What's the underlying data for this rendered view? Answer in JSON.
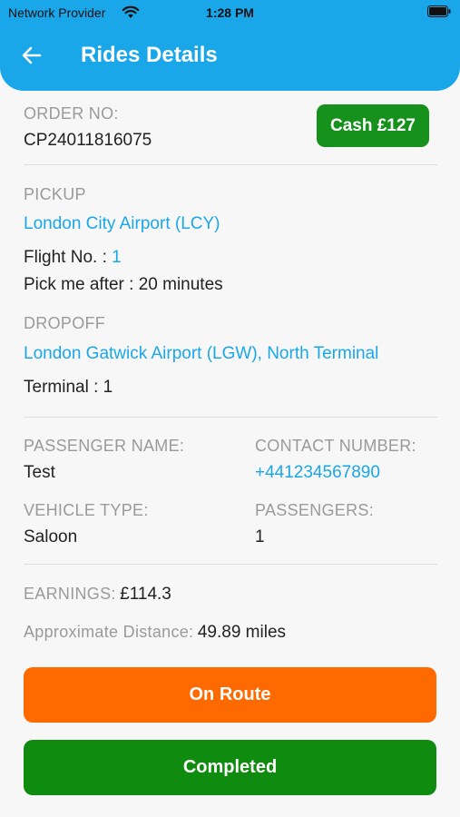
{
  "status_bar": {
    "carrier": "Network Provider",
    "time": "1:28 PM",
    "wifi_icon": "wifi-icon",
    "battery_icon": "battery-icon"
  },
  "header": {
    "title": "Rides Details",
    "back_icon": "back-arrow-icon",
    "color": "#1aa7ea"
  },
  "order": {
    "label": "ORDER NO:",
    "number": "CP24011816075",
    "payment_badge": "Cash £127",
    "badge_color": "#16911c"
  },
  "pickup": {
    "label": "PICKUP",
    "location": "London City Airport (LCY)",
    "flight_label": "Flight No. : ",
    "flight_number": "1",
    "pick_after": "Pick me after : 20 minutes"
  },
  "dropoff": {
    "label": "DROPOFF",
    "location": "London Gatwick Airport (LGW), North Terminal",
    "terminal": "Terminal : 1"
  },
  "passenger": {
    "name_label": "PASSENGER NAME:",
    "name": "Test",
    "contact_label": "CONTACT NUMBER:",
    "contact": "+441234567890",
    "vehicle_label": "VEHICLE TYPE:",
    "vehicle": "Saloon",
    "passengers_label": "PASSENGERS:",
    "passengers": "1"
  },
  "earnings": {
    "label": "EARNINGS:",
    "value": "£114.3",
    "distance_label": "Approximate Distance:",
    "distance_value": "49.89 miles"
  },
  "actions": {
    "on_route": "On Route",
    "on_route_color": "#ff6a00",
    "completed": "Completed",
    "completed_color": "#0f8c0f"
  }
}
